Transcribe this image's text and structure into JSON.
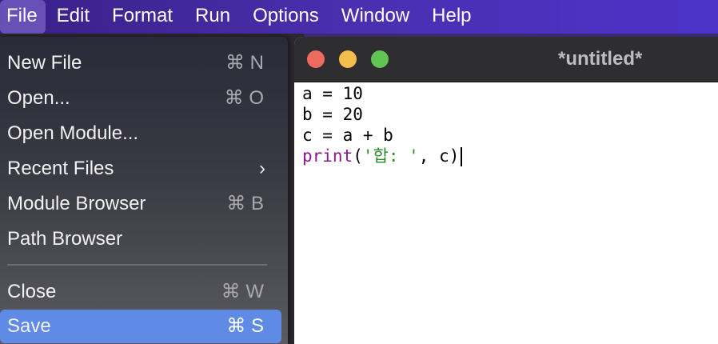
{
  "menubar": {
    "items": [
      "File",
      "Edit",
      "Format",
      "Run",
      "Options",
      "Window",
      "Help"
    ]
  },
  "file_menu": {
    "items": [
      {
        "label": "New File",
        "shortcut": "⌘ N"
      },
      {
        "label": "Open...",
        "shortcut": "⌘ O"
      },
      {
        "label": "Open Module...",
        "shortcut": ""
      },
      {
        "label": "Recent Files",
        "shortcut": ""
      },
      {
        "label": "Module Browser",
        "shortcut": "⌘ B"
      },
      {
        "label": "Path Browser",
        "shortcut": ""
      },
      {
        "label": "Close",
        "shortcut": "⌘ W"
      },
      {
        "label": "Save",
        "shortcut": "⌘ S"
      }
    ],
    "submenu_glyph": "›",
    "selected": "Save"
  },
  "editor": {
    "title": "*untitled*",
    "code": {
      "line1": "a = 10",
      "line2": "b = 20",
      "line3": "c = a + b",
      "line4_kw": "print",
      "line4_open": "(",
      "line4_str": "'합: '",
      "line4_rest": ", c)"
    }
  },
  "colors": {
    "menubar_accent": "#4a2fb0",
    "selected_item": "#5f8ae6",
    "close_light": "#ed6a5e",
    "minimize_light": "#f4be4f",
    "zoom_light": "#61c554",
    "keyword": "#8a1a8a",
    "string": "#2e8b2e"
  }
}
